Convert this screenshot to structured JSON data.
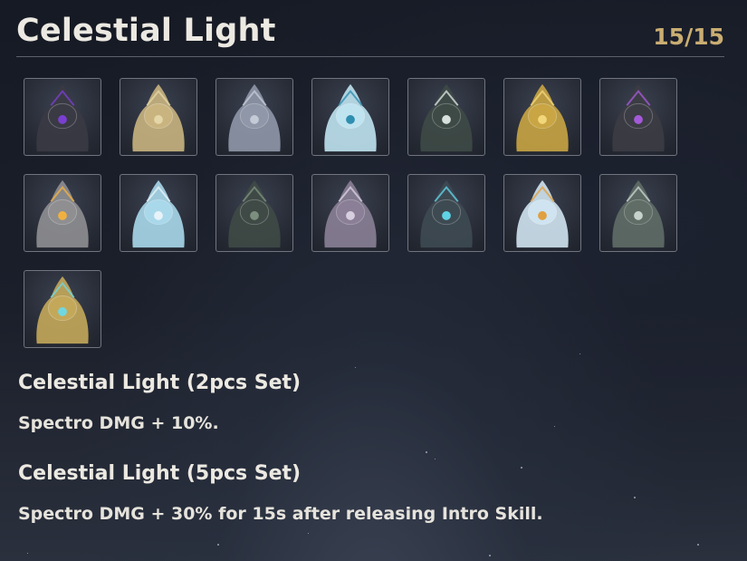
{
  "header": {
    "title": "Celestial Light",
    "count": "15/15"
  },
  "echoes": [
    {
      "name": "dark-mask-echo-icon",
      "color": "#3a3a44",
      "accent": "#7a3fd0"
    },
    {
      "name": "golden-flower-echo-icon",
      "color": "#c9b480",
      "accent": "#e4d6a6"
    },
    {
      "name": "pale-knight-echo-icon",
      "color": "#8f97a8",
      "accent": "#c4cad6"
    },
    {
      "name": "puffer-fish-echo-icon",
      "color": "#bfe3ef",
      "accent": "#2f8fb0"
    },
    {
      "name": "scythe-echo-icon",
      "color": "#3e4a46",
      "accent": "#d9e1df"
    },
    {
      "name": "gold-crown-echo-icon",
      "color": "#c9a544",
      "accent": "#f2d77a"
    },
    {
      "name": "crystal-beast-echo-icon",
      "color": "#3c3c44",
      "accent": "#a45ad8"
    },
    {
      "name": "stone-guardian-echo-icon",
      "color": "#8f8f92",
      "accent": "#f0b040"
    },
    {
      "name": "dragonfly-echo-icon",
      "color": "#a9d8ea",
      "accent": "#e7f3f8"
    },
    {
      "name": "shell-beast-echo-icon",
      "color": "#3f4a46",
      "accent": "#7c8f7e"
    },
    {
      "name": "horned-sage-echo-icon",
      "color": "#8a7f96",
      "accent": "#d7cfe0"
    },
    {
      "name": "mech-golem-echo-icon",
      "color": "#3e4a52",
      "accent": "#5fd2e6"
    },
    {
      "name": "ice-cube-echo-icon",
      "color": "#cfe3f0",
      "accent": "#e0a040"
    },
    {
      "name": "wolf-beast-echo-icon",
      "color": "#5f6d66",
      "accent": "#c7d2cc"
    },
    {
      "name": "winged-dragon-echo-icon",
      "color": "#c4a85a",
      "accent": "#6fd7e0"
    }
  ],
  "sets": [
    {
      "title": "Celestial Light (2pcs Set)",
      "desc": "Spectro DMG + 10%."
    },
    {
      "title": "Celestial Light (5pcs Set)",
      "desc": "Spectro DMG + 30% for 15s after releasing Intro Skill."
    }
  ]
}
